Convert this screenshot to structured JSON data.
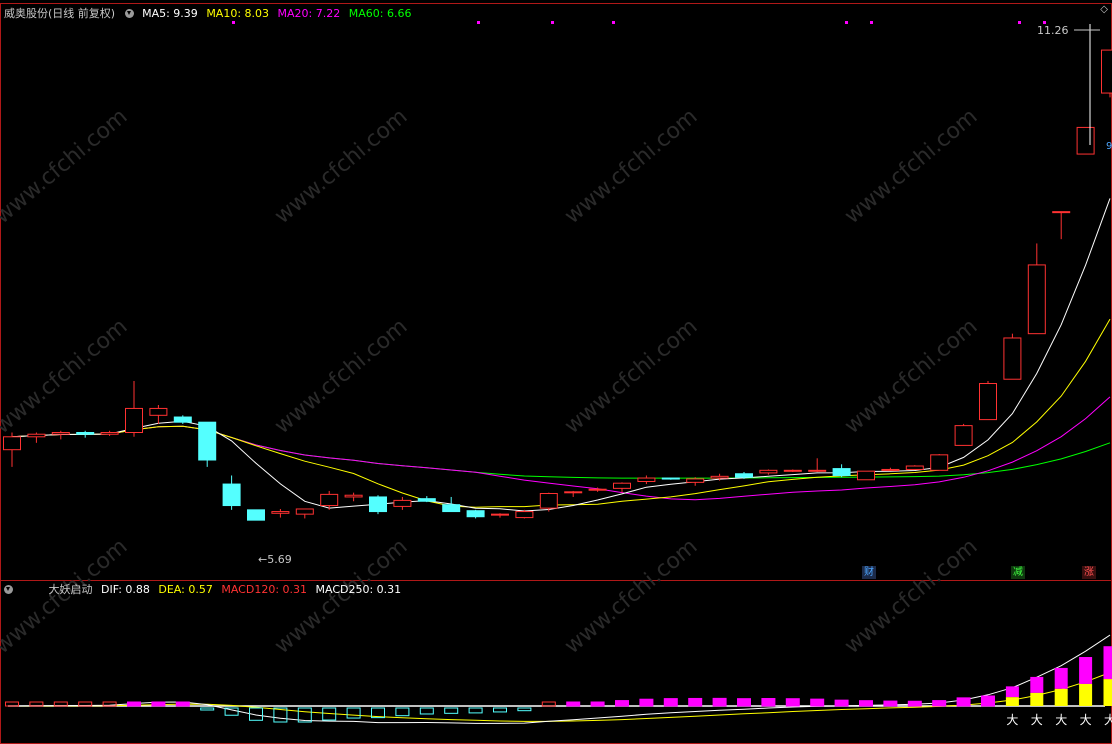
{
  "header": {
    "stock_title": "威奥股份(日线 前复权)",
    "ma5": "MA5: 9.39",
    "ma10": "MA10: 8.03",
    "ma20": "MA20: 7.22",
    "ma60": "MA60: 6.66"
  },
  "price_panel": {
    "high_label": "11.26",
    "low_label": "5.69",
    "right_edge_label": "9"
  },
  "events": {
    "cai": "财",
    "jian": "减",
    "zhang": "涨"
  },
  "indicator_header": {
    "name": "大妖启动",
    "dif": "DIF: 0.88",
    "dea": "DEA: 0.57",
    "macd120": "MACD120: 0.31",
    "macd250": "MACD250: 0.31"
  },
  "signal_glyph": "大",
  "watermark": "www.cfchi.com",
  "colors": {
    "up": "#ff3232",
    "down": "#54ffff",
    "ma5": "#ffffff",
    "ma10": "#ffff00",
    "ma20": "#ff00ff",
    "ma60": "#00ff00",
    "frame": "#b01818",
    "macd_top": "#ff00ff",
    "macd_bottom": "#ffff00"
  },
  "chart_data": {
    "type": "candlestick",
    "price_range": [
      5.2,
      11.6
    ],
    "candles": [
      {
        "o": 6.6,
        "h": 6.8,
        "l": 6.4,
        "c": 6.75
      },
      {
        "o": 6.75,
        "h": 6.8,
        "l": 6.68,
        "c": 6.78
      },
      {
        "o": 6.78,
        "h": 6.82,
        "l": 6.72,
        "c": 6.8
      },
      {
        "o": 6.8,
        "h": 6.82,
        "l": 6.74,
        "c": 6.78
      },
      {
        "o": 6.78,
        "h": 6.82,
        "l": 6.76,
        "c": 6.8
      },
      {
        "o": 6.8,
        "h": 7.4,
        "l": 6.75,
        "c": 7.08
      },
      {
        "o": 7.0,
        "h": 7.12,
        "l": 6.9,
        "c": 7.08
      },
      {
        "o": 6.98,
        "h": 7.0,
        "l": 6.9,
        "c": 6.92
      },
      {
        "o": 6.92,
        "h": 6.92,
        "l": 6.4,
        "c": 6.48
      },
      {
        "o": 6.2,
        "h": 6.3,
        "l": 5.9,
        "c": 5.95
      },
      {
        "o": 5.9,
        "h": 5.9,
        "l": 5.78,
        "c": 5.78
      },
      {
        "o": 5.86,
        "h": 5.91,
        "l": 5.81,
        "c": 5.88
      },
      {
        "o": 5.85,
        "h": 5.91,
        "l": 5.8,
        "c": 5.91
      },
      {
        "o": 5.95,
        "h": 6.12,
        "l": 5.9,
        "c": 6.08
      },
      {
        "o": 6.05,
        "h": 6.1,
        "l": 6.0,
        "c": 6.07
      },
      {
        "o": 6.05,
        "h": 6.07,
        "l": 5.85,
        "c": 5.88
      },
      {
        "o": 5.94,
        "h": 6.05,
        "l": 5.9,
        "c": 6.01
      },
      {
        "o": 6.03,
        "h": 6.06,
        "l": 5.99,
        "c": 6.0
      },
      {
        "o": 5.96,
        "h": 6.05,
        "l": 5.9,
        "c": 5.88
      },
      {
        "o": 5.89,
        "h": 5.9,
        "l": 5.8,
        "c": 5.82
      },
      {
        "o": 5.84,
        "h": 5.86,
        "l": 5.81,
        "c": 5.85
      },
      {
        "o": 5.81,
        "h": 5.9,
        "l": 5.8,
        "c": 5.88
      },
      {
        "o": 5.92,
        "h": 6.1,
        "l": 5.88,
        "c": 6.09
      },
      {
        "o": 6.1,
        "h": 6.12,
        "l": 6.05,
        "c": 6.11
      },
      {
        "o": 6.13,
        "h": 6.16,
        "l": 6.11,
        "c": 6.14
      },
      {
        "o": 6.15,
        "h": 6.22,
        "l": 6.1,
        "c": 6.21
      },
      {
        "o": 6.23,
        "h": 6.3,
        "l": 6.2,
        "c": 6.27
      },
      {
        "o": 6.27,
        "h": 6.27,
        "l": 6.25,
        "c": 6.26
      },
      {
        "o": 6.22,
        "h": 6.28,
        "l": 6.18,
        "c": 6.26
      },
      {
        "o": 6.27,
        "h": 6.32,
        "l": 6.24,
        "c": 6.29
      },
      {
        "o": 6.32,
        "h": 6.34,
        "l": 6.26,
        "c": 6.28
      },
      {
        "o": 6.33,
        "h": 6.37,
        "l": 6.31,
        "c": 6.36
      },
      {
        "o": 6.35,
        "h": 6.37,
        "l": 6.34,
        "c": 6.36
      },
      {
        "o": 6.36,
        "h": 6.5,
        "l": 6.34,
        "c": 6.36
      },
      {
        "o": 6.38,
        "h": 6.43,
        "l": 6.28,
        "c": 6.3
      },
      {
        "o": 6.25,
        "h": 6.35,
        "l": 6.25,
        "c": 6.35
      },
      {
        "o": 6.37,
        "h": 6.39,
        "l": 6.36,
        "c": 6.37
      },
      {
        "o": 6.37,
        "h": 6.42,
        "l": 6.37,
        "c": 6.41
      },
      {
        "o": 6.36,
        "h": 6.55,
        "l": 6.36,
        "c": 6.54
      },
      {
        "o": 6.65,
        "h": 6.9,
        "l": 6.65,
        "c": 6.88
      },
      {
        "o": 6.95,
        "h": 7.4,
        "l": 6.95,
        "c": 7.37
      },
      {
        "o": 7.42,
        "h": 7.95,
        "l": 7.42,
        "c": 7.9
      },
      {
        "o": 7.95,
        "h": 9.0,
        "l": 7.95,
        "c": 8.75
      },
      {
        "o": 9.37,
        "h": 9.37,
        "l": 9.05,
        "c": 9.37
      },
      {
        "o": 10.04,
        "h": 10.35,
        "l": 10.04,
        "c": 10.35
      },
      {
        "o": 10.75,
        "h": 11.25,
        "l": 10.7,
        "c": 11.25
      }
    ]
  }
}
